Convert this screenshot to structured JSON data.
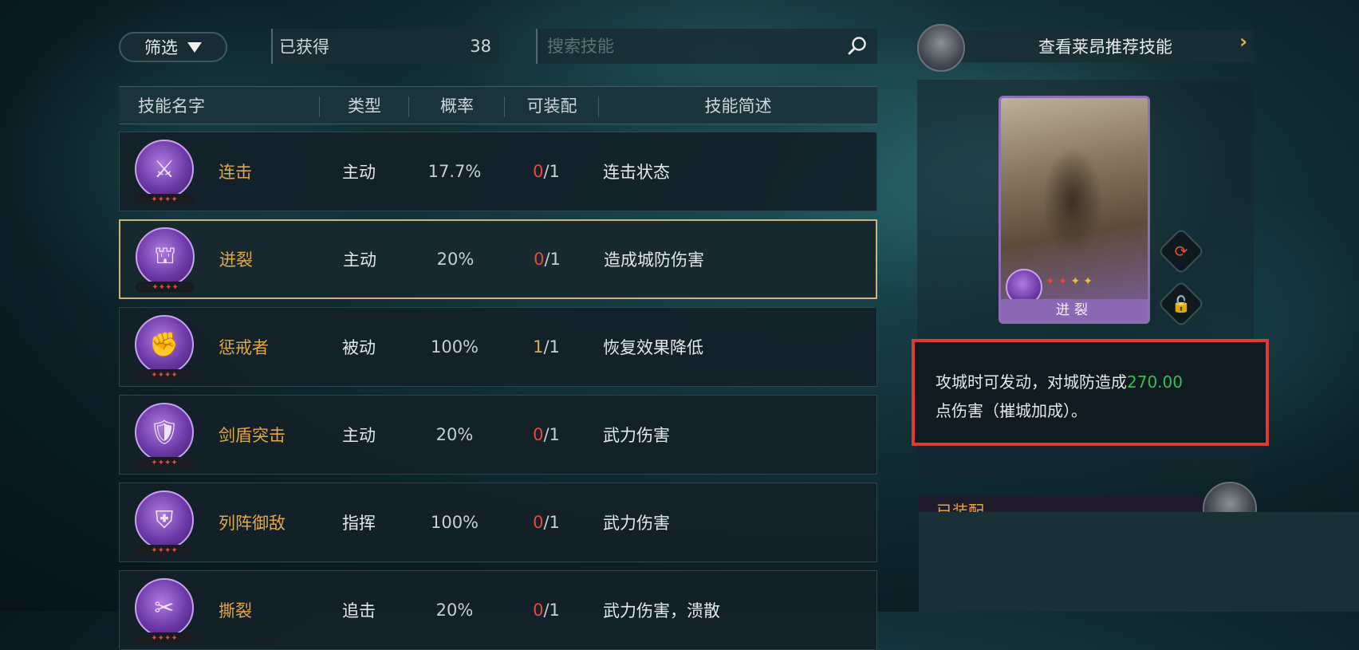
{
  "topbar": {
    "filter_label": "筛选",
    "owned_label": "已获得",
    "owned_count": "38",
    "search_placeholder": "搜索技能",
    "recommend_label": "查看莱昂推荐技能"
  },
  "table": {
    "headers": [
      "技能名字",
      "类型",
      "概率",
      "可装配",
      "技能简述"
    ],
    "rows": [
      {
        "name": "连击",
        "type": "主动",
        "rate": "17.7%",
        "equipped": "0",
        "equip_total": "/1",
        "desc": "连击状态",
        "icon": "sword-strike-icon"
      },
      {
        "name": "迸裂",
        "type": "主动",
        "rate": "20%",
        "equipped": "0",
        "equip_total": "/1",
        "desc": "造成城防伤害",
        "icon": "siege-icon"
      },
      {
        "name": "惩戒者",
        "type": "被动",
        "rate": "100%",
        "equipped": "1",
        "equip_total": "/1",
        "desc": "恢复效果降低",
        "icon": "punisher-icon"
      },
      {
        "name": "剑盾突击",
        "type": "主动",
        "rate": "20%",
        "equipped": "0",
        "equip_total": "/1",
        "desc": "武力伤害",
        "icon": "sword-shield-icon"
      },
      {
        "name": "列阵御敌",
        "type": "指挥",
        "rate": "100%",
        "equipped": "0",
        "equip_total": "/1",
        "desc": "武力伤害",
        "icon": "formation-icon"
      },
      {
        "name": "撕裂",
        "type": "追击",
        "rate": "20%",
        "equipped": "0",
        "equip_total": "/1",
        "desc": "武力伤害，溃散",
        "icon": "tear-icon"
      }
    ]
  },
  "detail": {
    "card_name": "迸裂",
    "description_prefix": "攻城时可发动，对城防造成",
    "description_value": "270.00",
    "description_suffix": "点伤害（摧城加成）。",
    "value_color": "#34c04a",
    "highlight_border_color": "#e03b33"
  },
  "equipped_section": {
    "label": "已装配"
  },
  "colors": {
    "skill_name": "#e0a64c",
    "equip_zero": "#e54a3a",
    "selected_border": "#cdb57a",
    "skill_icon_purple": "#6d3aa8"
  }
}
